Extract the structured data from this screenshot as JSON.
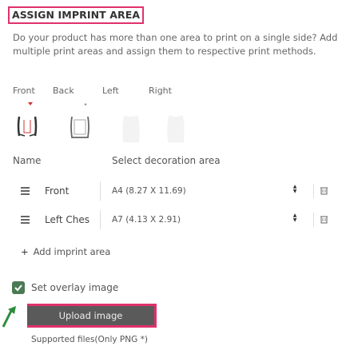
{
  "title": "ASSIGN IMPRINT AREA",
  "description": "Do your product has more than one area to print on a single side? Add multiple print areas and assign them to respective print methods.",
  "views": [
    "Front",
    "Back",
    "Left",
    "Right"
  ],
  "columns": {
    "name": "Name",
    "decoration": "Select decoration area"
  },
  "rows": [
    {
      "name": "Front",
      "area": "A4 (8.27 X 11.69)"
    },
    {
      "name": "Left Ches",
      "area": "A7 (4.13 X 2.91)"
    }
  ],
  "add_area": "Add imprint area",
  "overlay": {
    "label": "Set overlay image",
    "checked": true
  },
  "upload_label": "Upload image",
  "supported": "Supported files(Only PNG *)",
  "colors": {
    "highlight": "#e0316b",
    "check": "#4b7a54",
    "button": "#5a5a5a"
  }
}
